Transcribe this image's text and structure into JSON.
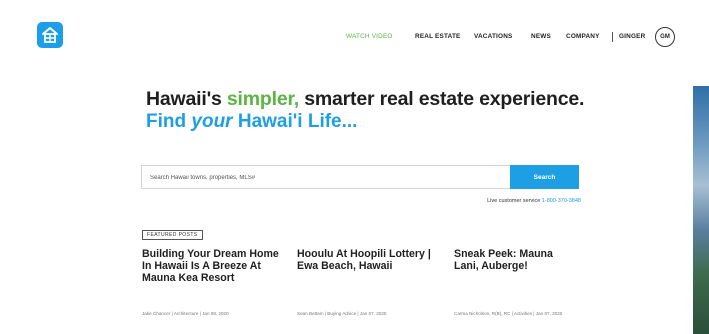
{
  "header": {
    "nav": [
      {
        "label": "WATCH VIDEO"
      },
      {
        "label": "REAL ESTATE"
      },
      {
        "label": "VACATIONS"
      },
      {
        "label": "NEWS"
      },
      {
        "label": "COMPANY"
      },
      {
        "label": "GINGER"
      }
    ],
    "avatar_initials": "GM"
  },
  "hero": {
    "headline_pre": "Hawaii's ",
    "headline_highlight": "simpler,",
    "headline_post": " smarter real estate experience.",
    "subhead_pre": "Find ",
    "subhead_em": "your",
    "subhead_post": " Hawai'i Life..."
  },
  "search": {
    "placeholder": "Search Hawaii towns, properties, MLS#",
    "button_label": "Search",
    "support_label": "Live customer service ",
    "support_phone": "1-800-370-3848"
  },
  "featured": {
    "tag": "FEATURED POSTS",
    "posts": [
      {
        "title": "Building Your Dream Home In Hawaii Is A Breeze At Mauna Kea Resort",
        "meta": "Jake Chancer | Architecture | Jan 08, 2020"
      },
      {
        "title": "Hooulu At Hoopili Lottery | Ewa Beach, Hawaii",
        "meta": "Sean Bettam | Buying Advice | Jan 07, 2020"
      },
      {
        "title": "Sneak Peek: Mauna Lani, Auberge!",
        "meta": "Carma Nicholson, R(B), RC | Activities | Jan 07, 2020"
      }
    ]
  },
  "colors": {
    "brand_blue": "#1e9fe3",
    "accent_green": "#5bb544"
  }
}
